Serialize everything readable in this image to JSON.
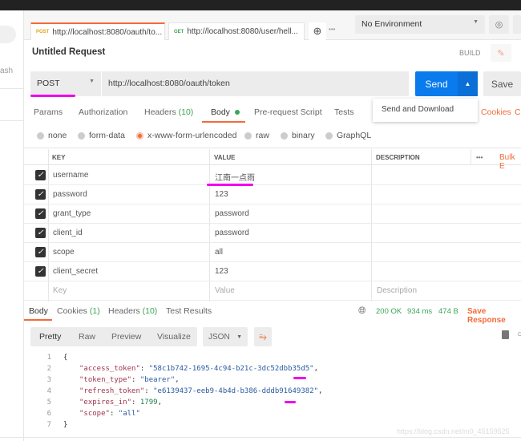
{
  "sidebar": {
    "partial_text": "ash"
  },
  "tabs": [
    {
      "method": "POST",
      "url": "http://localhost:8080/oauth/to...",
      "active": true
    },
    {
      "method": "GET",
      "url": "http://localhost:8080/user/hell..."
    }
  ],
  "environment": "No Environment",
  "request": {
    "title": "Untitled Request",
    "build": "BUILD",
    "method": "POST",
    "url": "http://localhost:8080/oauth/token",
    "send": "Send",
    "save": "Save",
    "send_menu": "Send and Download"
  },
  "req_tabs": {
    "params": "Params",
    "authorization": "Authorization",
    "headers": "Headers",
    "headers_count": "(10)",
    "body": "Body",
    "prerequest": "Pre-request Script",
    "tests": "Tests",
    "cookies": "Cookies",
    "code": "C"
  },
  "body_types": [
    "none",
    "form-data",
    "x-www-form-urlencoded",
    "raw",
    "binary",
    "GraphQL"
  ],
  "table": {
    "headers": {
      "key": "KEY",
      "value": "VALUE",
      "description": "DESCRIPTION",
      "more": "•••",
      "bulk": "Bulk E"
    },
    "rows": [
      {
        "key": "username",
        "value": "江南一点雨"
      },
      {
        "key": "password",
        "value": "123"
      },
      {
        "key": "grant_type",
        "value": "password"
      },
      {
        "key": "client_id",
        "value": "password"
      },
      {
        "key": "scope",
        "value": "all"
      },
      {
        "key": "client_secret",
        "value": "123"
      }
    ],
    "placeholder": {
      "key": "Key",
      "value": "Value",
      "description": "Description"
    }
  },
  "response": {
    "tabs": {
      "body": "Body",
      "cookies": "Cookies",
      "cookies_count": "(1)",
      "headers": "Headers",
      "headers_count": "(10)",
      "tests": "Test Results"
    },
    "status": "200 OK",
    "time": "934 ms",
    "size": "474 B",
    "save": "Save Response",
    "views": [
      "Pretty",
      "Raw",
      "Preview",
      "Visualize"
    ],
    "format": "JSON",
    "lines": [
      "1",
      "2",
      "3",
      "4",
      "5",
      "6",
      "7"
    ],
    "json": {
      "open": "{",
      "close": "}",
      "access_token_k": "\"access_token\"",
      "access_token_v": "\"58c1b742-1695-4c94-b21c-3dc52dbb35d5\"",
      "token_type_k": "\"token_type\"",
      "token_type_v": "\"bearer\"",
      "refresh_token_k": "\"refresh_token\"",
      "refresh_token_v": "\"e6139437-eeb9-4b4d-b386-dddb91649382\"",
      "expires_in_k": "\"expires_in\"",
      "expires_in_v": "1799",
      "scope_k": "\"scope\"",
      "scope_v": "\"all\""
    }
  },
  "watermark": "https://blog.csdn.net/m0_45159525",
  "colors": {
    "accent": "#f26b3a",
    "send": "#097bed",
    "status_ok": "#3aa655",
    "highlight": "#e000e0"
  }
}
